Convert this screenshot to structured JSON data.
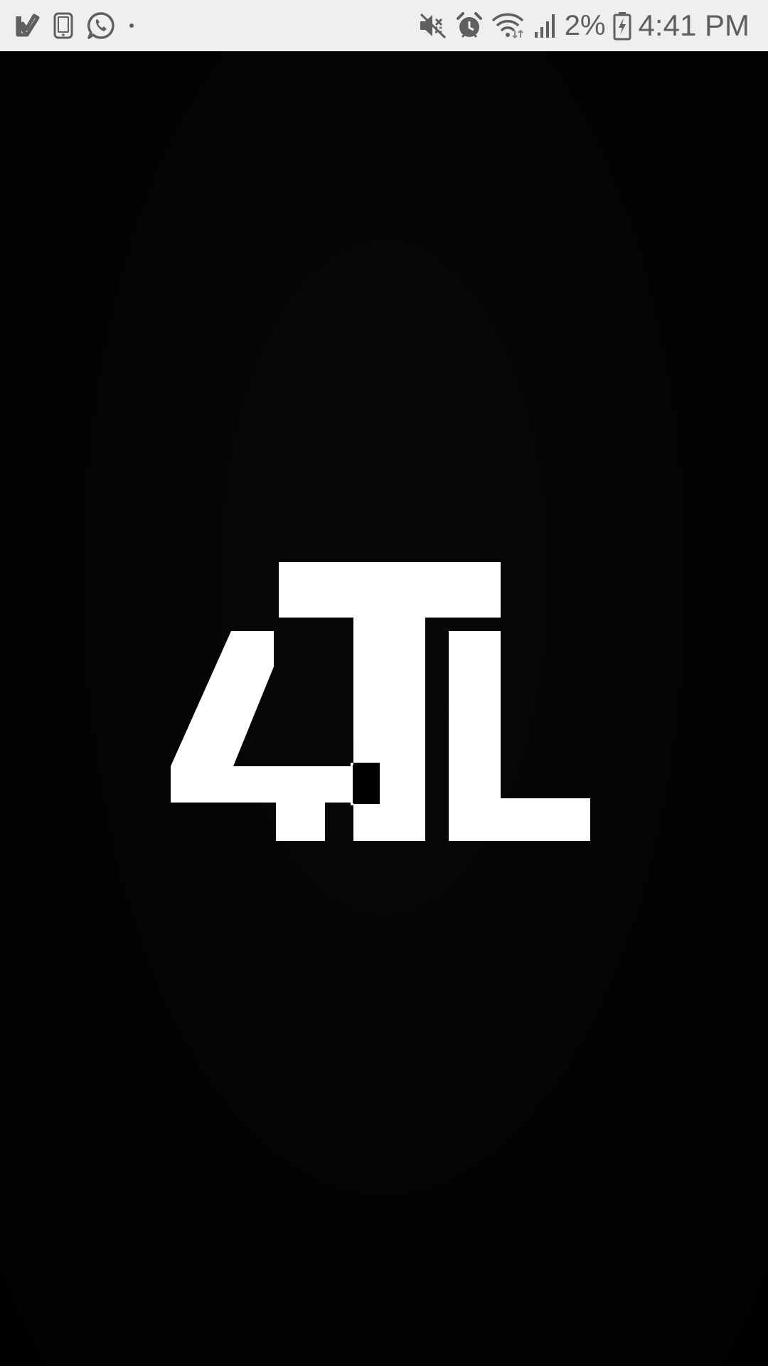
{
  "status_bar": {
    "left_icons": [
      "check-notification-icon",
      "phone-device-icon",
      "whatsapp-icon",
      "dot-icon"
    ],
    "right_icons": [
      "mute-icon",
      "alarm-icon",
      "wifi-icon",
      "signal-icon",
      "battery-charging-icon"
    ],
    "battery_percent": "2%",
    "time": "4:41 PM",
    "background": "#efefef",
    "icon_color": "#5f5f5f"
  },
  "splash": {
    "background": "#020203",
    "logo": {
      "name": "4TL",
      "color": "#ffffff"
    }
  }
}
